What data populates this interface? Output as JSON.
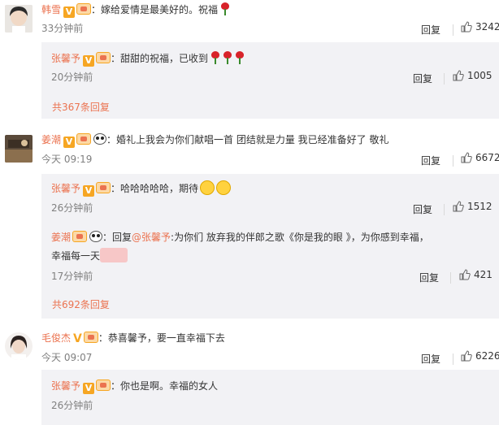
{
  "comments": [
    {
      "user": "韩雪",
      "text": "：嫁给爱情是最美好的。祝福",
      "time": "33分钟前",
      "reply_label": "回复",
      "likes": "3242",
      "subreplies": [
        {
          "user": "张馨予",
          "text": "：甜甜的祝福，已收到",
          "time": "20分钟前",
          "reply_label": "回复",
          "likes": "1005"
        }
      ],
      "more_replies": "共367条回复"
    },
    {
      "user": "姜潮",
      "text": "：婚礼上我会为你们献唱一首 团结就是力量 我已经准备好了 敬礼",
      "time": "今天 09:19",
      "reply_label": "回复",
      "likes": "6672",
      "subreplies": [
        {
          "user": "张馨予",
          "text": "：哈哈哈哈哈，期待",
          "time": "26分钟前",
          "reply_label": "回复",
          "likes": "1512"
        },
        {
          "user": "姜潮",
          "text_prefix": "：回复",
          "mention": "@张馨予",
          "text": ":为你们 放弃我的伴郎之歌《你是我的眼 》，为你感到幸福，",
          "text_line2": "幸福每一天",
          "time": "17分钟前",
          "reply_label": "回复",
          "likes": "421"
        }
      ],
      "more_replies": "共692条回复"
    },
    {
      "user": "毛俊杰",
      "text": "：恭喜馨予，要一直幸福下去",
      "time": "今天 09:07",
      "reply_label": "回复",
      "likes": "6226",
      "subreplies": [
        {
          "user": "张馨予",
          "text": "：你也是啊。幸福的女人",
          "time": "26分钟前"
        }
      ]
    }
  ],
  "icons": {
    "verified": "verified-v-icon",
    "member": "member-crown-icon",
    "panda": "panda-icon",
    "like": "thumbs-up-icon",
    "rose": "rose-emoji-icon"
  },
  "colors": {
    "username": "#eb7350",
    "verified": "#f6a623",
    "subreply_bg": "#f2f2f5",
    "time": "#808080"
  }
}
